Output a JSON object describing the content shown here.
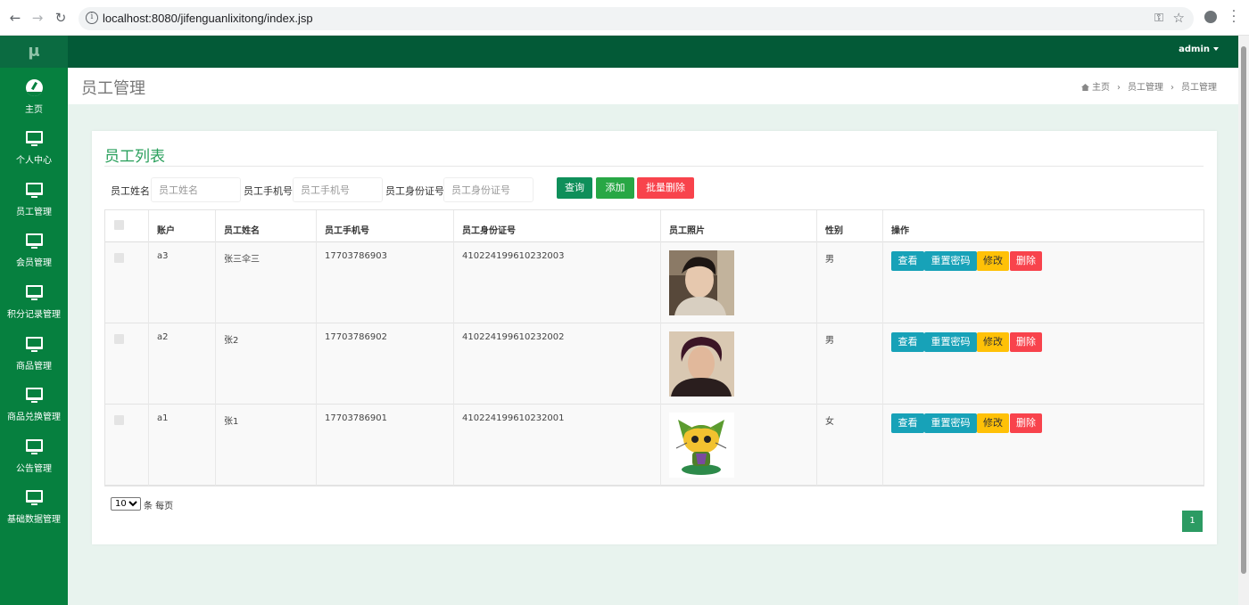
{
  "browser": {
    "url": "localhost:8080/jifenguanlixitong/index.jsp",
    "back": "←",
    "forward": "→",
    "reload": "↻",
    "info": "i",
    "key": "⚿",
    "star": "☆"
  },
  "header": {
    "logo": "μ",
    "user": "admin"
  },
  "sidebar": {
    "items": [
      {
        "label": "主页",
        "icon": "dashboard-icon"
      },
      {
        "label": "个人中心",
        "icon": "monitor-icon"
      },
      {
        "label": "员工管理",
        "icon": "monitor-icon"
      },
      {
        "label": "会员管理",
        "icon": "monitor-icon"
      },
      {
        "label": "积分记录管理",
        "icon": "monitor-icon"
      },
      {
        "label": "商品管理",
        "icon": "monitor-icon"
      },
      {
        "label": "商品兑换管理",
        "icon": "monitor-icon"
      },
      {
        "label": "公告管理",
        "icon": "monitor-icon"
      },
      {
        "label": "基础数据管理",
        "icon": "monitor-icon"
      }
    ]
  },
  "page": {
    "title": "员工管理",
    "breadcrumb": [
      "主页",
      "员工管理",
      "员工管理"
    ],
    "breadcrumb_sep": "›"
  },
  "card": {
    "title": "员工列表",
    "search": {
      "name_label": "员工姓名",
      "name_placeholder": "员工姓名",
      "phone_label": "员工手机号",
      "phone_placeholder": "员工手机号",
      "idcard_label": "员工身份证号",
      "idcard_placeholder": "员工身份证号"
    },
    "buttons": {
      "query": "查询",
      "add": "添加",
      "batch_delete": "批量删除"
    }
  },
  "table": {
    "headers": [
      "账户",
      "员工姓名",
      "员工手机号",
      "员工身份证号",
      "员工照片",
      "性别",
      "操作"
    ],
    "rows": [
      {
        "account": "a3",
        "name": "张三伞三",
        "phone": "17703786903",
        "idcard": "410224199610232003",
        "gender": "男"
      },
      {
        "account": "a2",
        "name": "张2",
        "phone": "17703786902",
        "idcard": "410224199610232002",
        "gender": "男"
      },
      {
        "account": "a1",
        "name": "张1",
        "phone": "17703786901",
        "idcard": "410224199610232001",
        "gender": "女"
      }
    ],
    "actions": {
      "view": "查看",
      "reset_password": "重置密码",
      "edit": "修改",
      "delete": "删除"
    }
  },
  "pagination": {
    "page_size": "10",
    "page_size_suffix": "条 每页",
    "current_page": "1"
  },
  "colors": {
    "topbar": "#035a37",
    "sidebar": "#06803f",
    "title_green": "#2aa05c",
    "btn_query": "#0f8f5a",
    "btn_add": "#28a745",
    "btn_delete": "#f8434c",
    "btn_view": "#17a2b8",
    "btn_edit": "#ffc107",
    "btn_remove": "#f8434c"
  }
}
